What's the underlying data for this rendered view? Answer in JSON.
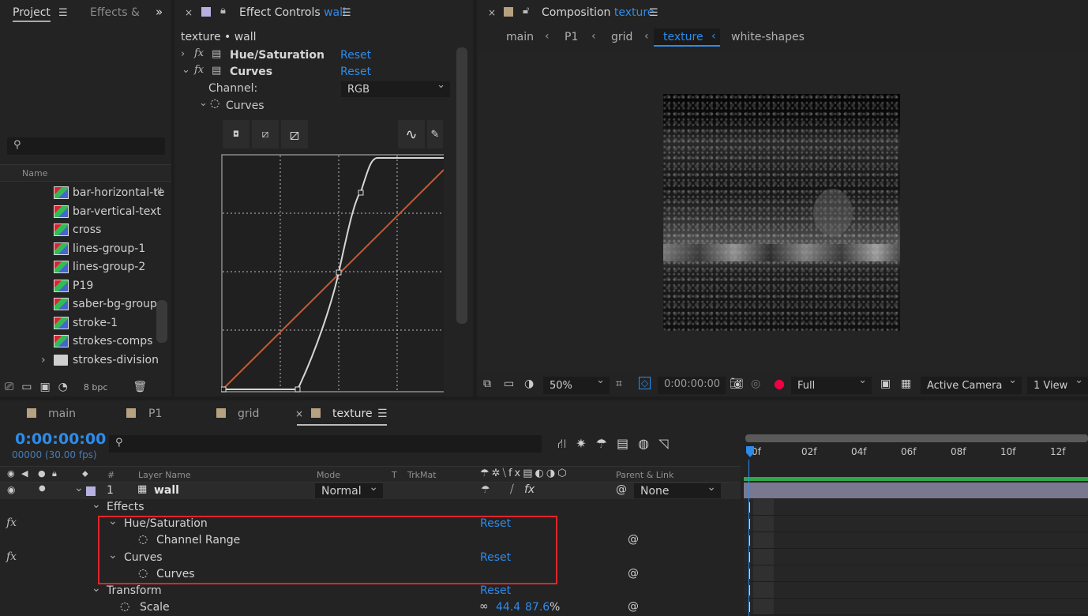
{
  "project": {
    "tab": "Project",
    "tab2": "Effects &",
    "search_placeholder": "",
    "name_header": "Name",
    "items": [
      {
        "label": "bar-horizontal-te",
        "kind": "comp"
      },
      {
        "label": "bar-vertical-text",
        "kind": "comp"
      },
      {
        "label": "cross",
        "kind": "comp"
      },
      {
        "label": "lines-group-1",
        "kind": "comp"
      },
      {
        "label": "lines-group-2",
        "kind": "comp"
      },
      {
        "label": "P19",
        "kind": "comp"
      },
      {
        "label": "saber-bg-group",
        "kind": "comp"
      },
      {
        "label": "stroke-1",
        "kind": "comp"
      },
      {
        "label": "strokes-comps",
        "kind": "comp"
      },
      {
        "label": "strokes-division",
        "kind": "folder"
      }
    ],
    "bpc": "8 bpc"
  },
  "effect_controls": {
    "title_prefix": "Effect Controls",
    "title_target": "wall",
    "subtitle": "texture • wall",
    "hue_label": "Hue/Saturation",
    "curves_label": "Curves",
    "reset": "Reset",
    "channel_label": "Channel:",
    "channel_value": "RGB",
    "curves_prop": "Curves",
    "fx": "fx"
  },
  "composition": {
    "title_prefix": "Composition",
    "title_target": "texture",
    "breadcrumbs": [
      "main",
      "P1",
      "grid",
      "texture",
      "white-shapes"
    ],
    "zoom": "50%",
    "time": "0:00:00:00",
    "resolution": "Full",
    "camera": "Active Camera",
    "view": "1 View"
  },
  "timeline": {
    "tabs": [
      "main",
      "P1",
      "grid",
      "texture"
    ],
    "timecode": "0:00:00:00",
    "fps": "00000 (30.00 fps)",
    "headers": {
      "layer_name": "Layer Name",
      "mode": "Mode",
      "t": "T",
      "trkmat": "TrkMat",
      "parent": "Parent & Link",
      "hash": "#"
    },
    "layer": {
      "num": "1",
      "name": "wall",
      "mode": "Normal",
      "parent": "None"
    },
    "props": {
      "effects": "Effects",
      "hue": "Hue/Saturation",
      "channel_range": "Channel Range",
      "curves": "Curves",
      "curves_prop": "Curves",
      "transform": "Transform",
      "scale": "Scale",
      "scale_x": "44.4",
      "scale_y": "87.6",
      "scale_unit": "%",
      "reset": "Reset",
      "fx": "fx"
    },
    "ruler": [
      "0f",
      "02f",
      "04f",
      "06f",
      "08f",
      "10f",
      "12f"
    ]
  },
  "colors": {
    "accent": "#2d8ceb",
    "highlight_box": "#e0252b",
    "timeline_bar": "#2ea84a"
  }
}
